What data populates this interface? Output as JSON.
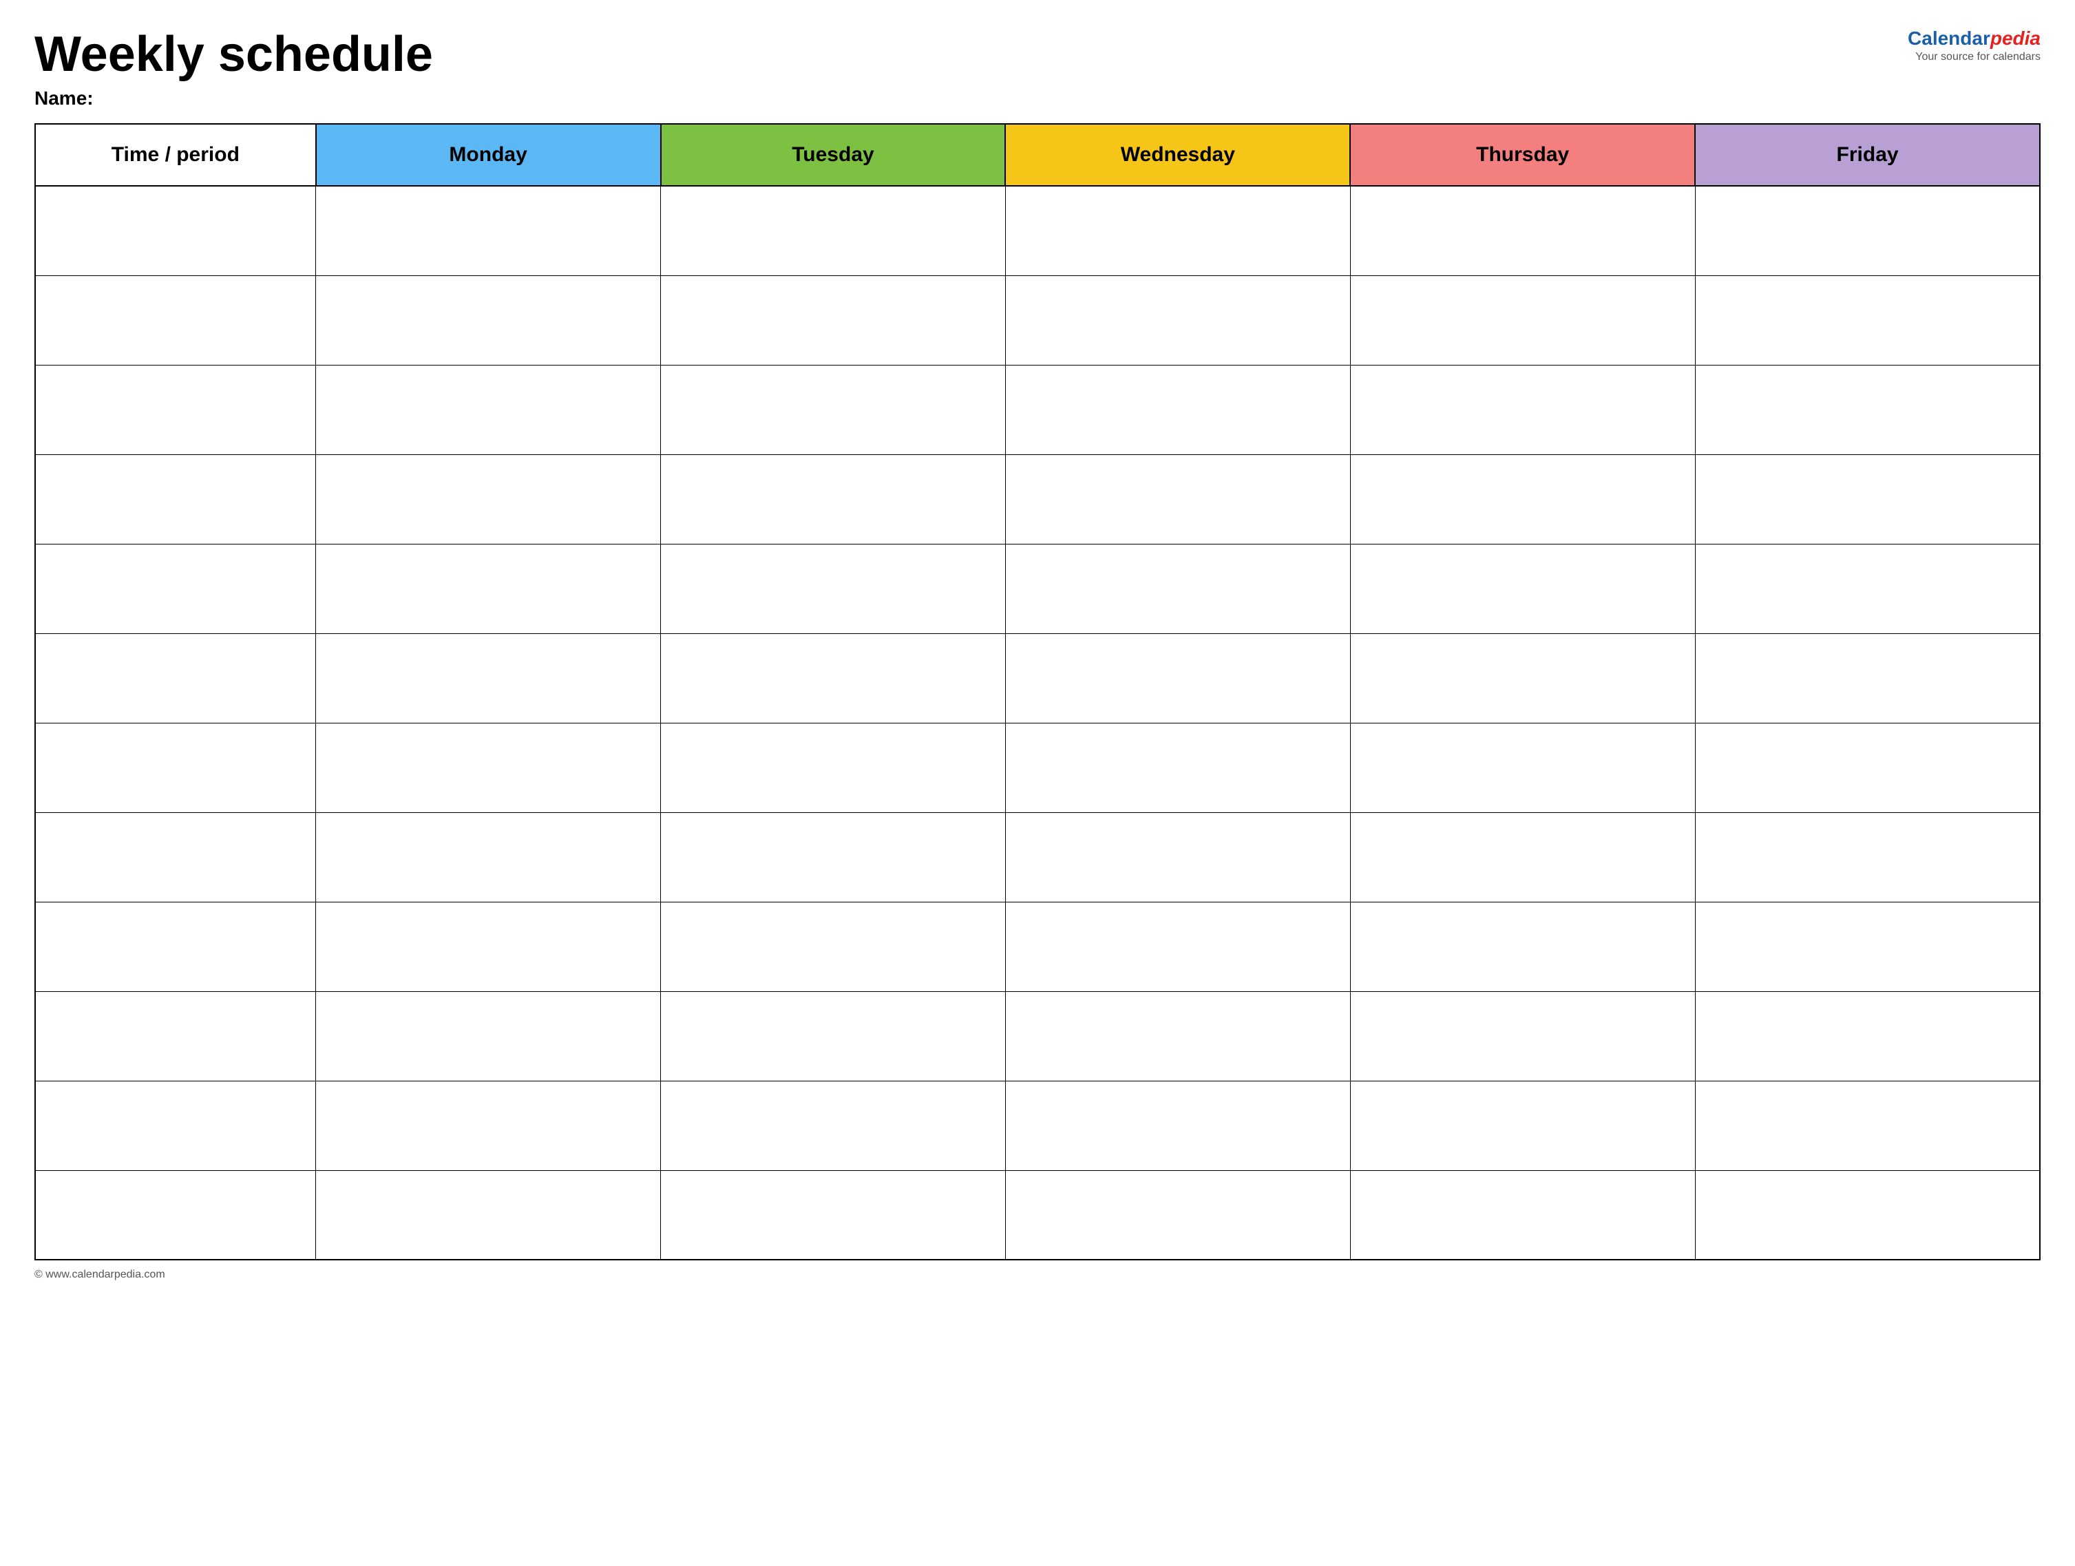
{
  "header": {
    "title": "Weekly schedule",
    "name_label": "Name:",
    "logo": {
      "calendar_text": "Calendar",
      "pedia_text": "pedia",
      "tagline": "Your source for calendars"
    }
  },
  "table": {
    "columns": [
      {
        "id": "time",
        "label": "Time / period",
        "color": "#ffffff"
      },
      {
        "id": "monday",
        "label": "Monday",
        "color": "#5bb8f5"
      },
      {
        "id": "tuesday",
        "label": "Tuesday",
        "color": "#7dc142"
      },
      {
        "id": "wednesday",
        "label": "Wednesday",
        "color": "#f5c518"
      },
      {
        "id": "thursday",
        "label": "Thursday",
        "color": "#f47f7f"
      },
      {
        "id": "friday",
        "label": "Friday",
        "color": "#b89fd4"
      }
    ],
    "row_count": 12
  },
  "footer": {
    "url": "© www.calendarpedia.com"
  }
}
